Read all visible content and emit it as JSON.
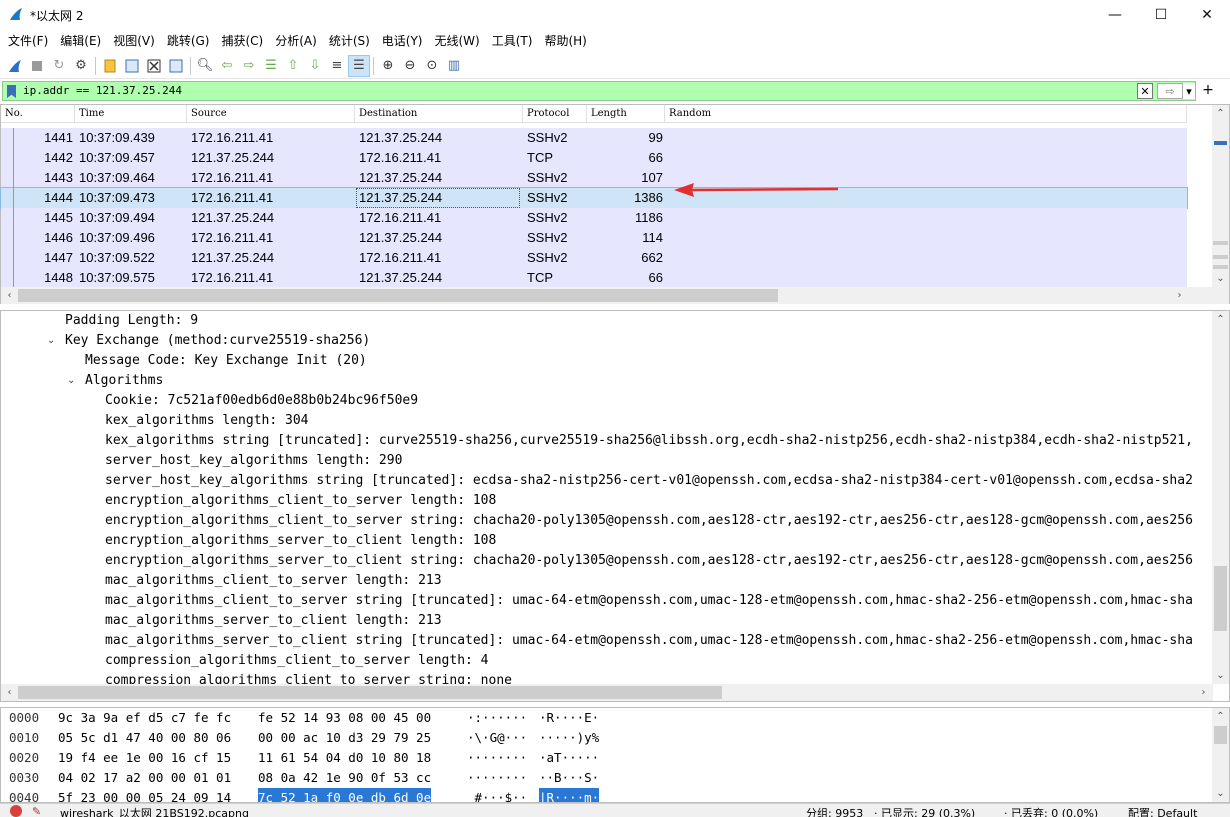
{
  "window": {
    "title": "*以太网 2",
    "minimize": "—",
    "maximize": "☐",
    "close": "✕"
  },
  "menu": [
    "文件(F)",
    "编辑(E)",
    "视图(V)",
    "跳转(G)",
    "捕获(C)",
    "分析(A)",
    "统计(S)",
    "电话(Y)",
    "无线(W)",
    "工具(T)",
    "帮助(H)"
  ],
  "toolbar": {
    "icons": [
      "shark-fin-start-icon",
      "stop-capture-icon",
      "restart-capture-icon",
      "capture-options-icon",
      "open-file-icon",
      "save-file-icon",
      "close-file-icon",
      "reload-icon",
      "find-packet-icon",
      "go-back-icon",
      "go-forward-icon",
      "go-to-packet-icon",
      "first-packet-icon",
      "last-packet-icon",
      "autoscroll-icon",
      "colorize-icon",
      "zoom-in-icon",
      "zoom-out-icon",
      "normal-size-icon",
      "resize-columns-icon"
    ]
  },
  "filter": {
    "value": "ip.addr == 121.37.25.244",
    "clear_glyph": "✕",
    "apply_glyph": "⇨",
    "dropdown_glyph": "▾",
    "add_glyph": "+"
  },
  "packet_list": {
    "columns": [
      "No.",
      "Time",
      "Source",
      "Destination",
      "Protocol",
      "Length",
      "Random"
    ],
    "rows": [
      {
        "no": "1441",
        "time": "10:37:09.439",
        "src": "172.16.211.41",
        "dst": "121.37.25.244",
        "proto": "SSHv2",
        "len": "99"
      },
      {
        "no": "1442",
        "time": "10:37:09.457",
        "src": "121.37.25.244",
        "dst": "172.16.211.41",
        "proto": "TCP",
        "len": "66"
      },
      {
        "no": "1443",
        "time": "10:37:09.464",
        "src": "172.16.211.41",
        "dst": "121.37.25.244",
        "proto": "SSHv2",
        "len": "107"
      },
      {
        "no": "1444",
        "time": "10:37:09.473",
        "src": "172.16.211.41",
        "dst": "121.37.25.244",
        "proto": "SSHv2",
        "len": "1386"
      },
      {
        "no": "1445",
        "time": "10:37:09.494",
        "src": "121.37.25.244",
        "dst": "172.16.211.41",
        "proto": "SSHv2",
        "len": "1186"
      },
      {
        "no": "1446",
        "time": "10:37:09.496",
        "src": "172.16.211.41",
        "dst": "121.37.25.244",
        "proto": "SSHv2",
        "len": "114"
      },
      {
        "no": "1447",
        "time": "10:37:09.522",
        "src": "121.37.25.244",
        "dst": "172.16.211.41",
        "proto": "SSHv2",
        "len": "662"
      },
      {
        "no": "1448",
        "time": "10:37:09.575",
        "src": "172.16.211.41",
        "dst": "121.37.25.244",
        "proto": "TCP",
        "len": "66"
      }
    ],
    "selected_no": "1444",
    "row_bg": "#e7e6ff",
    "selected_bg": "#cfe4f7"
  },
  "details": [
    {
      "text": "Padding Length: 9",
      "indent": 0,
      "toggle": ""
    },
    {
      "text": "Key Exchange (method:curve25519-sha256)",
      "indent": 0,
      "toggle": "expanded"
    },
    {
      "text": "Message Code: Key Exchange Init (20)",
      "indent": 1,
      "toggle": ""
    },
    {
      "text": "Algorithms",
      "indent": 1,
      "toggle": "expanded"
    },
    {
      "text": "Cookie: 7c521af00edb6d0e88b0b24bc96f50e9",
      "indent": 2,
      "toggle": ""
    },
    {
      "text": "kex_algorithms length: 304",
      "indent": 2,
      "toggle": ""
    },
    {
      "text": "kex_algorithms string [truncated]: curve25519-sha256,curve25519-sha256@libssh.org,ecdh-sha2-nistp256,ecdh-sha2-nistp384,ecdh-sha2-nistp521,",
      "indent": 2,
      "toggle": ""
    },
    {
      "text": "server_host_key_algorithms length: 290",
      "indent": 2,
      "toggle": ""
    },
    {
      "text": "server_host_key_algorithms string [truncated]: ecdsa-sha2-nistp256-cert-v01@openssh.com,ecdsa-sha2-nistp384-cert-v01@openssh.com,ecdsa-sha2",
      "indent": 2,
      "toggle": ""
    },
    {
      "text": "encryption_algorithms_client_to_server length: 108",
      "indent": 2,
      "toggle": ""
    },
    {
      "text": "encryption_algorithms_client_to_server string: chacha20-poly1305@openssh.com,aes128-ctr,aes192-ctr,aes256-ctr,aes128-gcm@openssh.com,aes256",
      "indent": 2,
      "toggle": ""
    },
    {
      "text": "encryption_algorithms_server_to_client length: 108",
      "indent": 2,
      "toggle": ""
    },
    {
      "text": "encryption_algorithms_server_to_client string: chacha20-poly1305@openssh.com,aes128-ctr,aes192-ctr,aes256-ctr,aes128-gcm@openssh.com,aes256",
      "indent": 2,
      "toggle": ""
    },
    {
      "text": "mac_algorithms_client_to_server length: 213",
      "indent": 2,
      "toggle": ""
    },
    {
      "text": "mac_algorithms_client_to_server string [truncated]: umac-64-etm@openssh.com,umac-128-etm@openssh.com,hmac-sha2-256-etm@openssh.com,hmac-sha",
      "indent": 2,
      "toggle": ""
    },
    {
      "text": "mac_algorithms_server_to_client length: 213",
      "indent": 2,
      "toggle": ""
    },
    {
      "text": "mac_algorithms_server_to_client string [truncated]: umac-64-etm@openssh.com,umac-128-etm@openssh.com,hmac-sha2-256-etm@openssh.com,hmac-sha",
      "indent": 2,
      "toggle": ""
    },
    {
      "text": "compression_algorithms_client_to_server length: 4",
      "indent": 2,
      "toggle": ""
    },
    {
      "text": "compression_algorithms_client_to_server string: none",
      "indent": 2,
      "toggle": ""
    }
  ],
  "bytes": [
    {
      "off": "0000",
      "hex_a": "9c 3a 9a ef d5 c7 fe fc",
      "hex_b": "fe 52 14 93 08 00 45 00",
      "ascii_a": "·:······",
      "ascii_b": "·R····E·",
      "hl": false
    },
    {
      "off": "0010",
      "hex_a": "05 5c d1 47 40 00 80 06",
      "hex_b": "00 00 ac 10 d3 29 79 25",
      "ascii_a": "·\\·G@···",
      "ascii_b": "·····)y%",
      "hl": false
    },
    {
      "off": "0020",
      "hex_a": "19 f4 ee 1e 00 16 cf 15",
      "hex_b": "11 61 54 04 d0 10 80 18",
      "ascii_a": "········",
      "ascii_b": "·aT·····",
      "hl": false
    },
    {
      "off": "0030",
      "hex_a": "04 02 17 a2 00 00 01 01",
      "hex_b": "08 0a 42 1e 90 0f 53 cc",
      "ascii_a": "········",
      "ascii_b": "··B···S·",
      "hl": false
    },
    {
      "off": "0040",
      "hex_a": "5f 23 00 00 05 24 09 14",
      "hex_b": "7c 52 1a f0 0e db 6d 0e",
      "ascii_a": "_#···$··",
      "ascii_b": "|R····m·",
      "hl": true
    }
  ],
  "status": {
    "file": "wireshark_以太网 21BS192.pcapng",
    "packets": "分组: 9953",
    "displayed": "· 已显示: 29 (0.3%)",
    "dropped": "· 已丢弃: 0 (0.0%)",
    "profile": "配置: Default"
  },
  "colors": {
    "filter_bg": "#afffaf",
    "arrow": "#e03030",
    "highlight": "#2a78d6"
  }
}
